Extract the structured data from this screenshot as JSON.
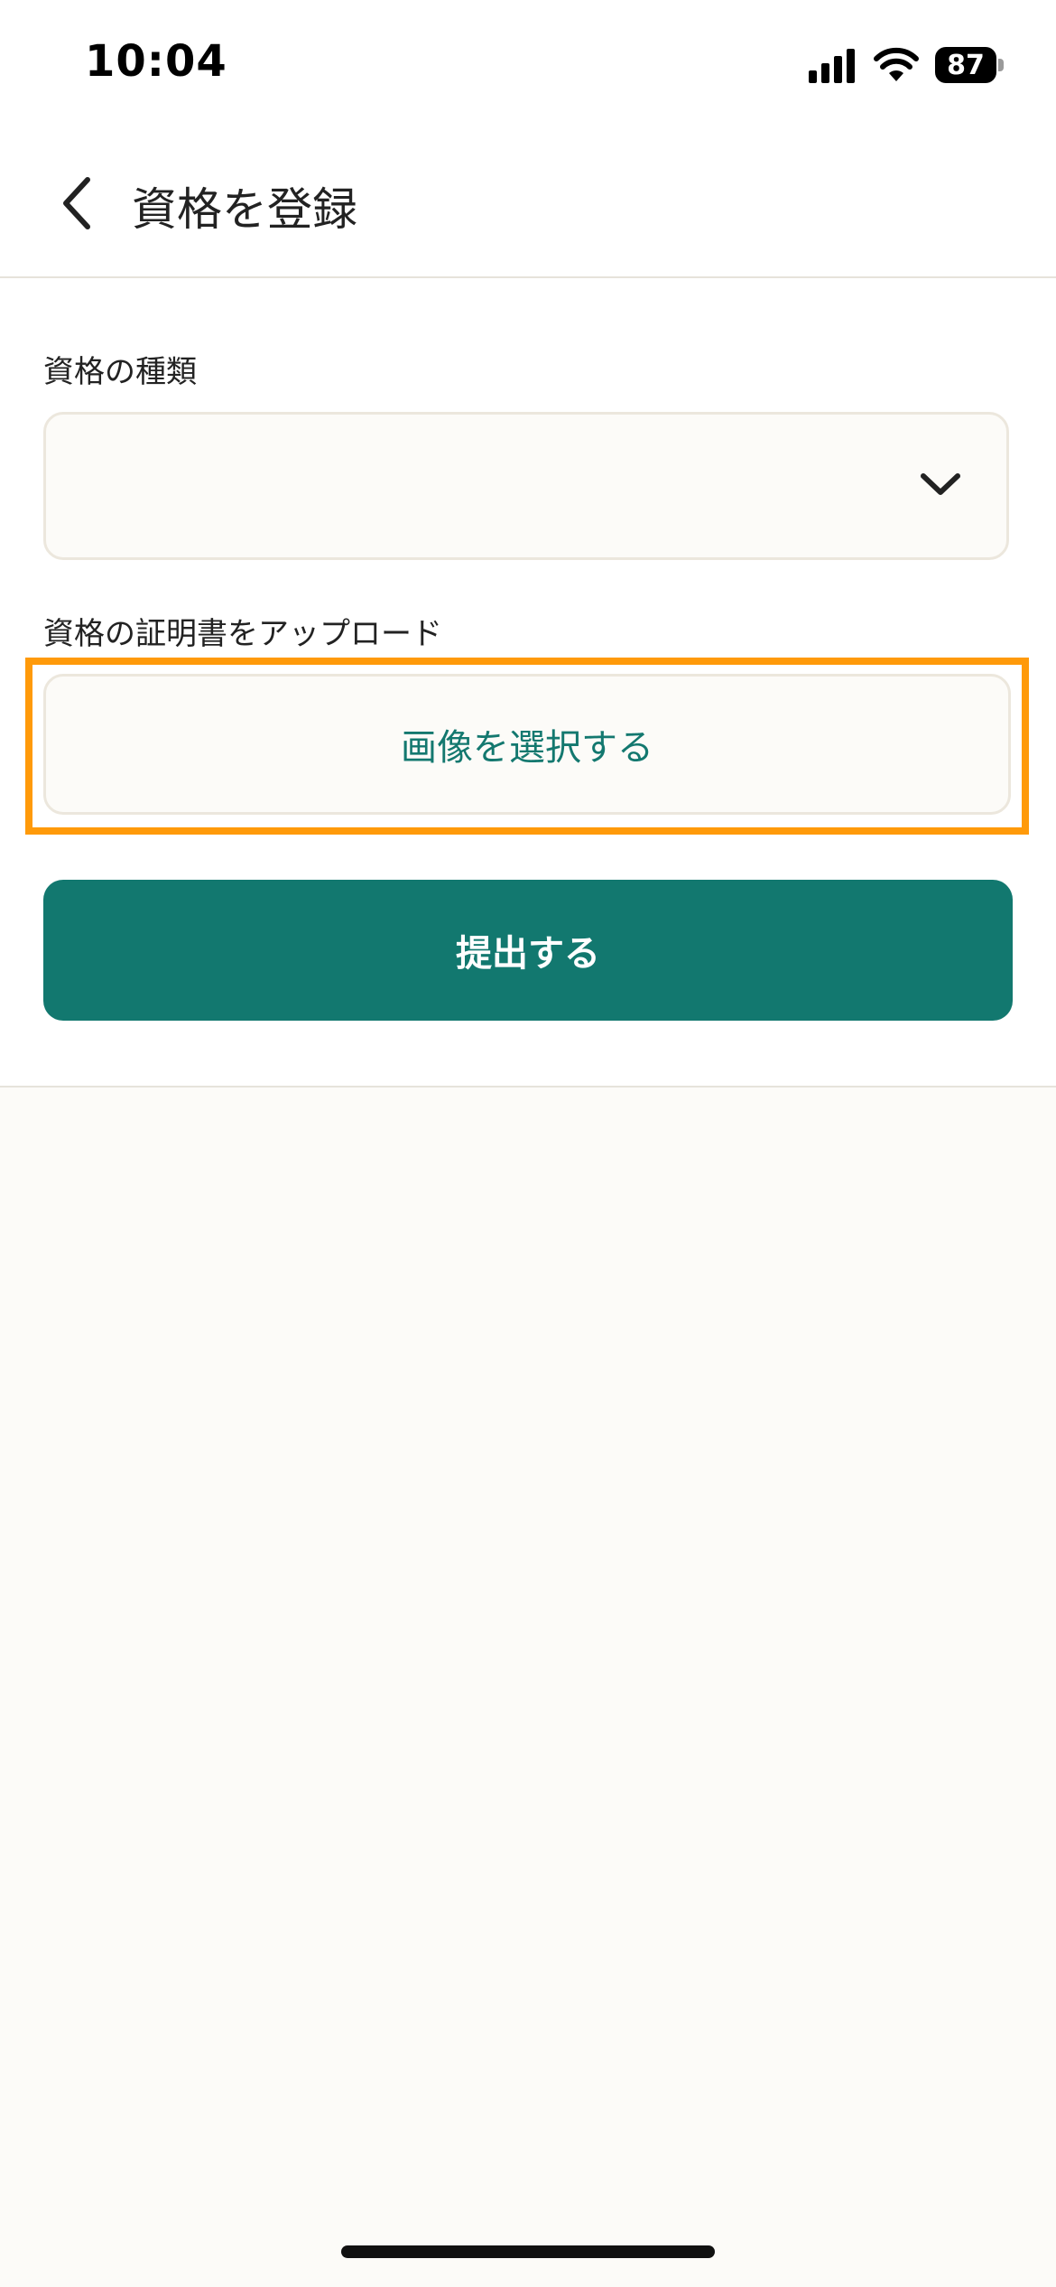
{
  "status_bar": {
    "time": "10:04",
    "battery": "87",
    "icons": [
      "signal-icon",
      "wifi-icon",
      "battery-icon"
    ]
  },
  "header": {
    "title": "資格を登録",
    "back_icon": "chevron-left-icon"
  },
  "form": {
    "qualification_type_label": "資格の種類",
    "qualification_type_value": "",
    "upload_label": "資格の証明書をアップロード",
    "image_select_label": "画像を選択する",
    "submit_label": "提出する"
  },
  "colors": {
    "accent": "#12786F",
    "highlight": "#FF9A0A",
    "background": "#FCFBF8"
  }
}
